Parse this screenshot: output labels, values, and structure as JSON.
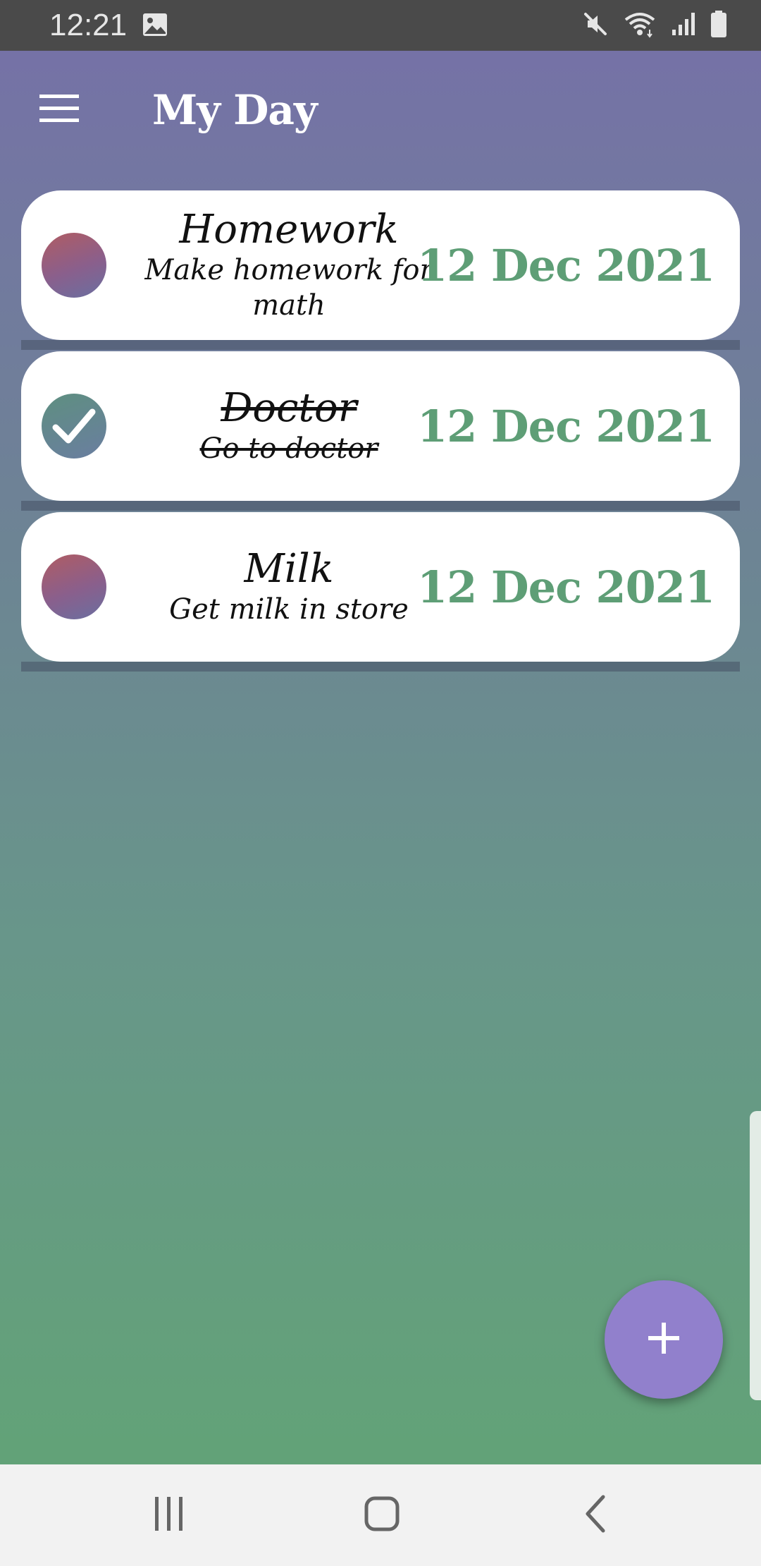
{
  "status_bar": {
    "time": "12:21",
    "icons": [
      "gallery-icon",
      "mute-icon",
      "wifi-icon",
      "signal-icon",
      "battery-icon"
    ]
  },
  "app_bar": {
    "title": "My Day",
    "menu_icon": "hamburger-menu-icon"
  },
  "tasks": [
    {
      "title": "Homework",
      "description": "Make homework for math",
      "date": "12 Dec 2021",
      "completed": false
    },
    {
      "title": "Doctor",
      "description": "Go to doctor",
      "date": "12 Dec 2021",
      "completed": true
    },
    {
      "title": "Milk",
      "description": "Get milk in store",
      "date": "12 Dec 2021",
      "completed": false
    }
  ],
  "fab": {
    "icon": "plus-icon"
  },
  "nav_bar": {
    "icons": [
      "recent-apps-icon",
      "home-icon",
      "back-icon"
    ]
  },
  "colors": {
    "date_green": "#5e9e76",
    "fab_purple": "#9180cc",
    "gradient_top": "#7670a8",
    "gradient_bottom": "#61a574"
  }
}
